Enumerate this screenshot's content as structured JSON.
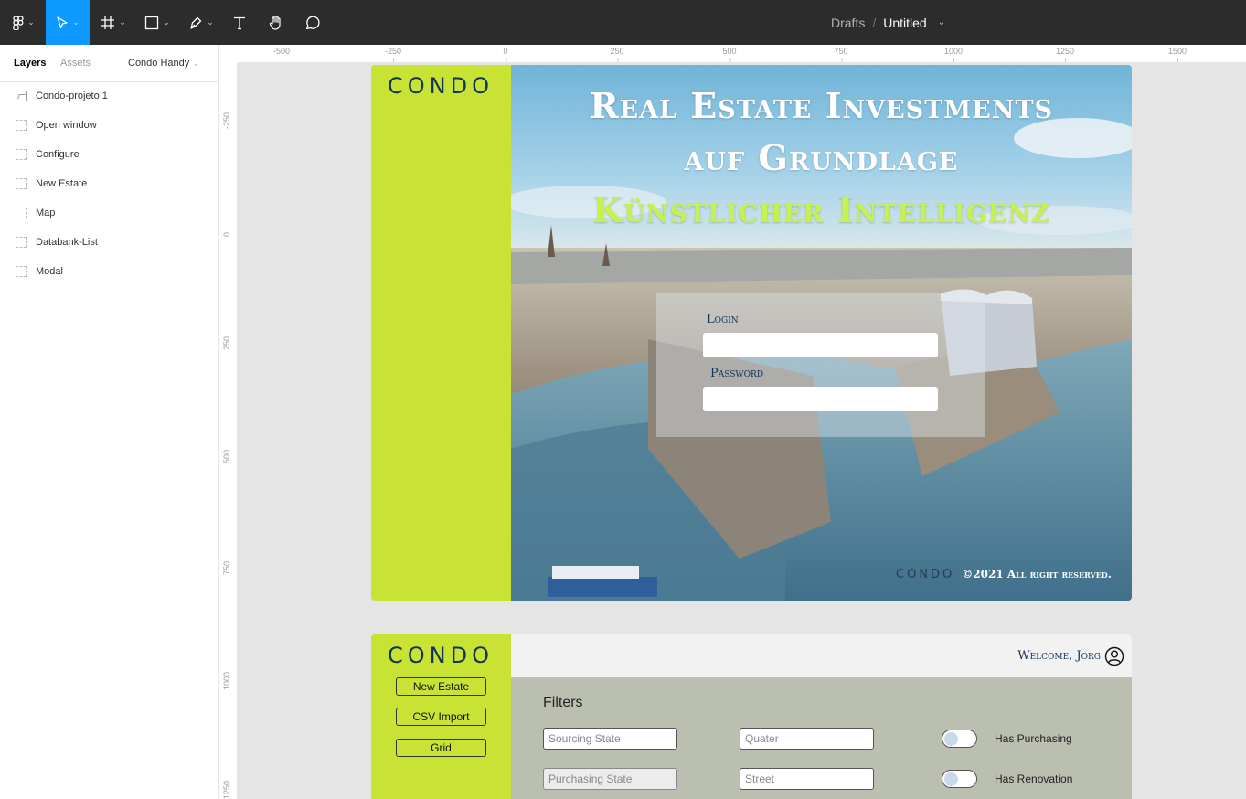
{
  "toolbar": {
    "breadcrumb_drafts": "Drafts",
    "breadcrumb_sep": "/",
    "file_name": "Untitled",
    "active_tool": "move-tool",
    "accent": "#0d99ff"
  },
  "left_panel": {
    "tab_layers": "Layers",
    "tab_assets": "Assets",
    "page_name": "Condo Handy",
    "layers": [
      {
        "label": "Condo-projeto 1",
        "icon": "image-icon"
      },
      {
        "label": "Open window",
        "icon": "frame-icon"
      },
      {
        "label": "Configure",
        "icon": "frame-icon"
      },
      {
        "label": "New Estate",
        "icon": "frame-icon"
      },
      {
        "label": "Map",
        "icon": "frame-icon"
      },
      {
        "label": "Databank-List",
        "icon": "frame-icon"
      },
      {
        "label": "Modal",
        "icon": "frame-icon"
      }
    ]
  },
  "rulers": {
    "h": [
      "-500",
      "-250",
      "0",
      "250",
      "500",
      "750",
      "1000",
      "1250",
      "1500"
    ],
    "v": [
      "-250",
      "0",
      "250",
      "500",
      "750",
      "1000",
      "1250"
    ]
  },
  "login_frame": {
    "logo": "CONDO",
    "headline_1": "Real Estate Investments",
    "headline_2": "auf Grundlage",
    "headline_3": "Künstlicher Intelligenz",
    "login_label": "Login",
    "password_label": "Password",
    "footer_logo": "CONDO",
    "copyright": "©2021 All right reserved.",
    "brand_green": "#c8e334",
    "brand_navy": "#13325b"
  },
  "dashboard_frame": {
    "logo": "CONDO",
    "buttons": [
      "New Estate",
      "CSV Import",
      "Grid"
    ],
    "welcome": "Welcome, Jorg",
    "filters_title": "Filters",
    "inputs": {
      "sourcing_state": "Sourcing State",
      "quater": "Quater",
      "purchasing_state": "Purchasing State",
      "street": "Street"
    },
    "toggles": [
      "Has Purchasing",
      "Has Renovation"
    ]
  }
}
